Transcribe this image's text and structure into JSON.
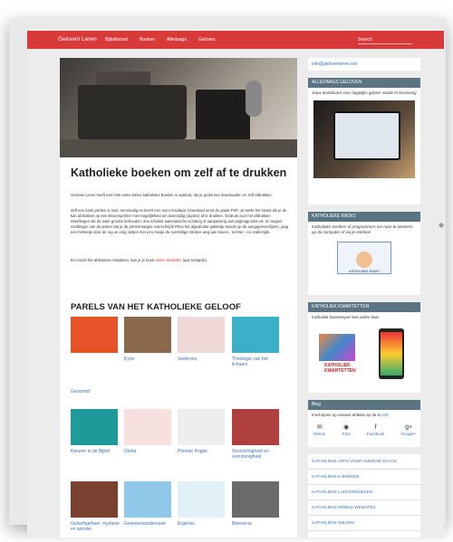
{
  "header": {
    "brand": "Geloven Leren",
    "nav": [
      "Bijbelbrood",
      "Boeken",
      "Alledaags",
      "Geloven"
    ],
    "search_placeholder": "Search"
  },
  "main": {
    "title": "Katholieke boeken om zelf af te drukken",
    "para1": "Geloven Leren heeft een hele reeks kleine katholieke boeken in aanbod, die je gratis kan downloaden en zelf afdrukken.",
    "para2": "Zelf een boek printen is snel, eenvoudig en levert een mooi resultaat. Download eerst de gratis PDF. Je werkt het snelst als je de kan afdrukken op een kleurenprinter met mogelijkheid om tweezijdig (duplex) af te drukken. Gebruik voor het afdrukken instellingen die de ware grootte behouden, dus schakel automatische schaling of aanpassing aan paginagrootte uit, en negeer meldingen van de printer dat je de printermarges overschrijdt! Plooi het afgedrukte pakketje steeds op de aangeprevenlijnen, jaag een hetnietje door de rug en enig nietjes met een mesje de overtollige stroken weg aan boven-, rechter-, en onderzijde.",
    "para3_pre": "En mocht het afdrukken mislukken, kan je je boek ",
    "para3_link": "online bestellen",
    "para3_post": " (aan kostprijs).",
    "section_title": "PARELS VAN HET KATHOLIEKE GELOOF",
    "books": [
      {
        "label": "Gevormd!",
        "color": "#e8542a"
      },
      {
        "label": "Kyrie",
        "color": "#8a6a4a"
      },
      {
        "label": "Vederons",
        "color": "#f0d8d8"
      },
      {
        "label": "Theologie van het lichaam",
        "color": "#3cb0c8"
      },
      {
        "label": "Kleuren in de Bijbel",
        "color": "#1e9a9a"
      },
      {
        "label": "Gloria",
        "color": "#f6e0e0"
      },
      {
        "label": "Priester Poppe",
        "color": "#eeeeee"
      },
      {
        "label": "Voorzichtigheid en voorzienigheid",
        "color": "#b04040"
      },
      {
        "label": "Geloofsgeheel, mysterie en wonder",
        "color": "#7a4030"
      },
      {
        "label": "Gewetensonderzoek",
        "color": "#8fc8e8"
      },
      {
        "label": "Ergernis",
        "color": "#e0f0f6"
      },
      {
        "label": "Beleverss",
        "color": "#6a6a6a"
      }
    ]
  },
  "sidebar": {
    "email": "info@gelovenleren.net",
    "alledaags": {
      "head": "ALLEDAAGS GELOVEN",
      "text": "Jouw dashboard voor dagelijks gebed, studie et bezinning"
    },
    "radio": {
      "head": "KATHOLIEKE RADIO",
      "text": "Katholieke zenders of programma's om naar te luisteren op de computer of via je telefoon",
      "logo": "KATHOLIEKE RADIO"
    },
    "kwartetten": {
      "head": "KATHOLIEK KWARTETTEN",
      "text": "Katholiek kwartetspel met online kwis",
      "logo1": "KATHOLIEK",
      "logo2": "KWARTETTEN"
    },
    "blog": {
      "head": "Blog",
      "text_pre": "Inschrijven op nieuwe artikels op de ",
      "text_link": "BLOG",
      "icons": [
        "EMAIL",
        "RSS",
        "Facebook",
        "Google+"
      ]
    },
    "links": [
      "KATHOLIEKE APPS VOOR ANDROID EN IOS",
      "KATHOLIEKE E-BOEKEN",
      "KATHOLIEKE LUISTERBOEKEN",
      "KATHOLIEKE MOBILE WEBSITES",
      "KATHOLIEKE NIEUWS"
    ]
  }
}
